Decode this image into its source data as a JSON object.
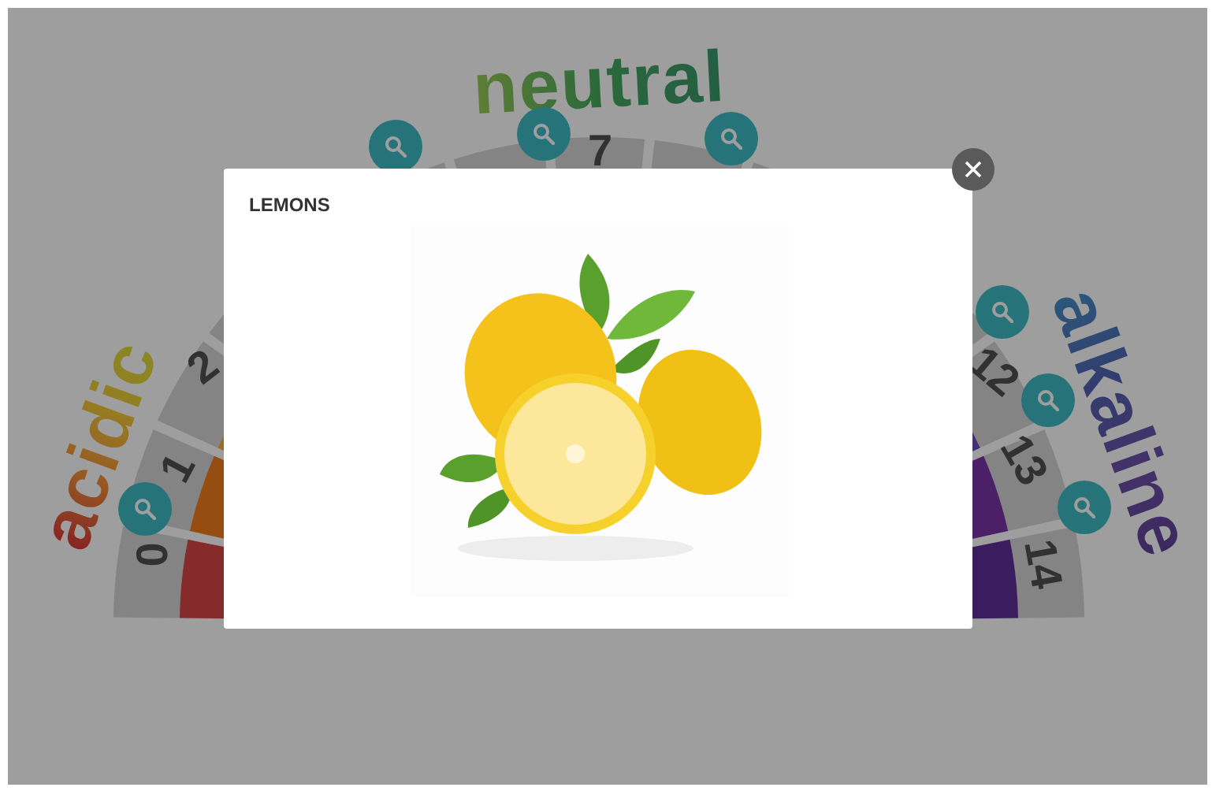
{
  "scale": {
    "labels": [
      {
        "text": "acidic",
        "kind": "acidic"
      },
      {
        "text": "neutral",
        "kind": "neutral"
      },
      {
        "text": "alkaline",
        "kind": "alkaline"
      }
    ],
    "numbers": [
      "0",
      "1",
      "2",
      "7",
      "12",
      "13",
      "14"
    ]
  },
  "modal": {
    "title": "LEMONS"
  }
}
